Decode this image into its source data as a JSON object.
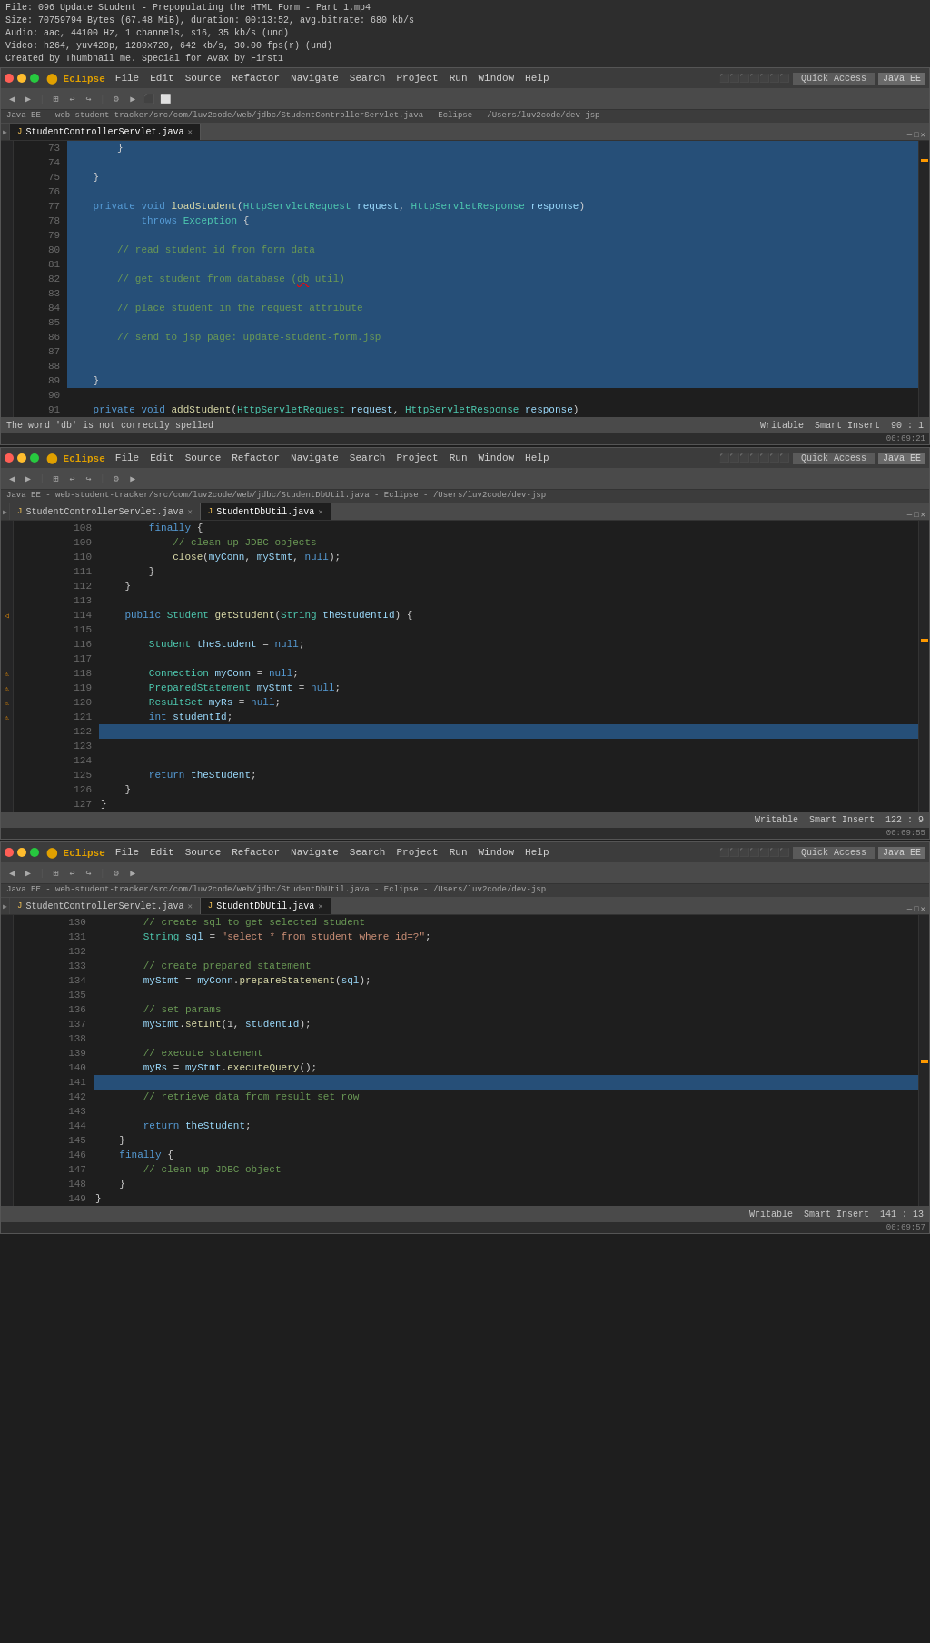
{
  "fileInfo": {
    "line1": "File: 096 Update Student - Prepopulating the HTML Form - Part 1.mp4",
    "line2": "Size: 70759794 Bytes (67.48 MiB), duration: 00:13:52, avg.bitrate: 680 kb/s",
    "line3": "Audio: aac, 44100 Hz, 1 channels, s16, 35 kb/s (und)",
    "line4": "Video: h264, yuv420p, 1280x720, 642 kb/s, 30.00 fps(r) (und)",
    "line5": "Created by Thumbnail me. Special for Avax by First1"
  },
  "windows": [
    {
      "id": "window1",
      "menuItems": [
        "Eclipse",
        "File",
        "Edit",
        "Source",
        "Refactor",
        "Navigate",
        "Search",
        "Project",
        "Run",
        "Window",
        "Help"
      ],
      "pathBar": "Java EE - web-student-tracker/src/com/luv2code/web/jdbc/StudentControllerServlet.java - Eclipse - /Users/luv2code/dev-jsp",
      "quickAccess": "Quick Access",
      "javaEE": "Java EE",
      "tabs": [
        {
          "label": "StudentControllerServlet.java",
          "active": true
        }
      ],
      "editorLines": [
        {
          "num": "73",
          "content": "        }",
          "selected": true
        },
        {
          "num": "74",
          "content": "",
          "selected": true
        },
        {
          "num": "75",
          "content": "    }",
          "selected": true
        },
        {
          "num": "76",
          "content": "",
          "selected": true
        },
        {
          "num": "77",
          "content": "    private void loadStudent(HttpServletRequest request, HttpServletResponse response)",
          "selected": true
        },
        {
          "num": "78",
          "content": "            throws Exception {",
          "selected": true
        },
        {
          "num": "79",
          "content": "",
          "selected": true
        },
        {
          "num": "80",
          "content": "        // read student id from form data",
          "selected": true
        },
        {
          "num": "81",
          "content": "",
          "selected": true
        },
        {
          "num": "82",
          "content": "        // get student from database (db util)",
          "selected": true
        },
        {
          "num": "83",
          "content": "",
          "selected": true
        },
        {
          "num": "84",
          "content": "        // place student in the request attribute",
          "selected": true
        },
        {
          "num": "85",
          "content": "",
          "selected": true
        },
        {
          "num": "86",
          "content": "        // send to jsp page: update-student-form.jsp",
          "selected": true
        },
        {
          "num": "87",
          "content": "",
          "selected": true
        },
        {
          "num": "88",
          "content": "",
          "selected": true
        },
        {
          "num": "89",
          "content": "    }",
          "selected": true
        },
        {
          "num": "90",
          "content": "",
          "selected": false
        },
        {
          "num": "91",
          "content": "    private void addStudent(HttpServletRequest request, HttpServletResponse response)",
          "selected": false
        }
      ],
      "statusBar": {
        "left": "The word 'db' is not correctly spelled",
        "writable": "Writable",
        "smartInsert": "Smart Insert",
        "position": "90 : 1"
      },
      "timestamp": "00:69:21"
    },
    {
      "id": "window2",
      "menuItems": [
        "Eclipse",
        "File",
        "Edit",
        "Source",
        "Refactor",
        "Navigate",
        "Search",
        "Project",
        "Run",
        "Window",
        "Help"
      ],
      "pathBar": "Java EE - web-student-tracker/src/com/luv2code/web/jdbc/StudentDbUtil.java - Eclipse - /Users/luv2code/dev-jsp",
      "quickAccess": "Quick Access",
      "javaEE": "Java EE",
      "tabs": [
        {
          "label": "StudentControllerServlet.java",
          "active": false
        },
        {
          "label": "StudentDbUtil.java",
          "active": true
        }
      ],
      "editorLines": [
        {
          "num": "108",
          "content": "        finally {",
          "selected": false
        },
        {
          "num": "109",
          "content": "            // clean up JDBC objects",
          "selected": false
        },
        {
          "num": "110",
          "content": "            close(myConn, myStmt, null);",
          "selected": false
        },
        {
          "num": "111",
          "content": "        }",
          "selected": false
        },
        {
          "num": "112",
          "content": "    }",
          "selected": false
        },
        {
          "num": "113",
          "content": "",
          "selected": false
        },
        {
          "num": "114",
          "content": "    public Student getStudent(String theStudentId) {",
          "selected": false
        },
        {
          "num": "115",
          "content": "",
          "selected": false
        },
        {
          "num": "116",
          "content": "        Student theStudent = null;",
          "selected": false
        },
        {
          "num": "117",
          "content": "",
          "selected": false
        },
        {
          "num": "118",
          "content": "        Connection myConn = null;",
          "selected": false
        },
        {
          "num": "119",
          "content": "        PreparedStatement myStmt = null;",
          "selected": false
        },
        {
          "num": "120",
          "content": "        ResultSet myRs = null;",
          "selected": false
        },
        {
          "num": "121",
          "content": "        int studentId;",
          "selected": false
        },
        {
          "num": "122",
          "content": "",
          "selected": true
        },
        {
          "num": "123",
          "content": "",
          "selected": false
        },
        {
          "num": "124",
          "content": "",
          "selected": false
        },
        {
          "num": "125",
          "content": "        return theStudent;",
          "selected": false
        },
        {
          "num": "126",
          "content": "    }",
          "selected": false
        },
        {
          "num": "127",
          "content": "}",
          "selected": false
        }
      ],
      "statusBar": {
        "left": "",
        "writable": "Writable",
        "smartInsert": "Smart Insert",
        "position": "122 : 9"
      },
      "timestamp": "00:69:55"
    },
    {
      "id": "window3",
      "menuItems": [
        "Eclipse",
        "File",
        "Edit",
        "Source",
        "Refactor",
        "Navigate",
        "Search",
        "Project",
        "Run",
        "Window",
        "Help"
      ],
      "pathBar": "Java EE - web-student-tracker/src/com/luv2code/web/jdbc/StudentDbUtil.java - Eclipse - /Users/luv2code/dev-jsp",
      "quickAccess": "Quick Access",
      "javaEE": "Java EE",
      "tabs": [
        {
          "label": "StudentControllerServlet.java",
          "active": false
        },
        {
          "label": "StudentDbUtil.java",
          "active": true
        }
      ],
      "editorLines": [
        {
          "num": "130",
          "content": "        // create sql to get selected student",
          "selected": false
        },
        {
          "num": "131",
          "content": "        String sql = \"select * from student where id=?\";",
          "selected": false
        },
        {
          "num": "132",
          "content": "",
          "selected": false
        },
        {
          "num": "133",
          "content": "        // create prepared statement",
          "selected": false
        },
        {
          "num": "134",
          "content": "        myStmt = myConn.prepareStatement(sql);",
          "selected": false
        },
        {
          "num": "135",
          "content": "",
          "selected": false
        },
        {
          "num": "136",
          "content": "        // set params",
          "selected": false
        },
        {
          "num": "137",
          "content": "        myStmt.setInt(1, studentId);",
          "selected": false
        },
        {
          "num": "138",
          "content": "",
          "selected": false
        },
        {
          "num": "139",
          "content": "        // execute statement",
          "selected": false
        },
        {
          "num": "140",
          "content": "        myRs = myStmt.executeQuery();",
          "selected": false
        },
        {
          "num": "141",
          "content": "",
          "selected": false
        },
        {
          "num": "142",
          "content": "        // retrieve data from result set row",
          "selected": false
        },
        {
          "num": "143",
          "content": "",
          "selected": false
        },
        {
          "num": "144",
          "content": "        return theStudent;",
          "selected": false
        },
        {
          "num": "145",
          "content": "    }",
          "selected": false
        },
        {
          "num": "146",
          "content": "    finally {",
          "selected": false
        },
        {
          "num": "147",
          "content": "        // clean up JDBC object",
          "selected": false
        },
        {
          "num": "148",
          "content": "    }",
          "selected": false
        },
        {
          "num": "149",
          "content": "}",
          "selected": false
        }
      ],
      "statusBar": {
        "left": "",
        "writable": "Writable",
        "smartInsert": "Smart Insert",
        "position": "141 : 13"
      },
      "timestamp": "00:69:57"
    }
  ],
  "colors": {
    "keyword": "#569cd6",
    "type": "#4ec9b0",
    "comment": "#6a9955",
    "string": "#ce9178",
    "method": "#dcdcaa",
    "param": "#9cdcfe",
    "background": "#1e1e1e",
    "selected": "#264f78",
    "statusBar": "#007acc"
  }
}
